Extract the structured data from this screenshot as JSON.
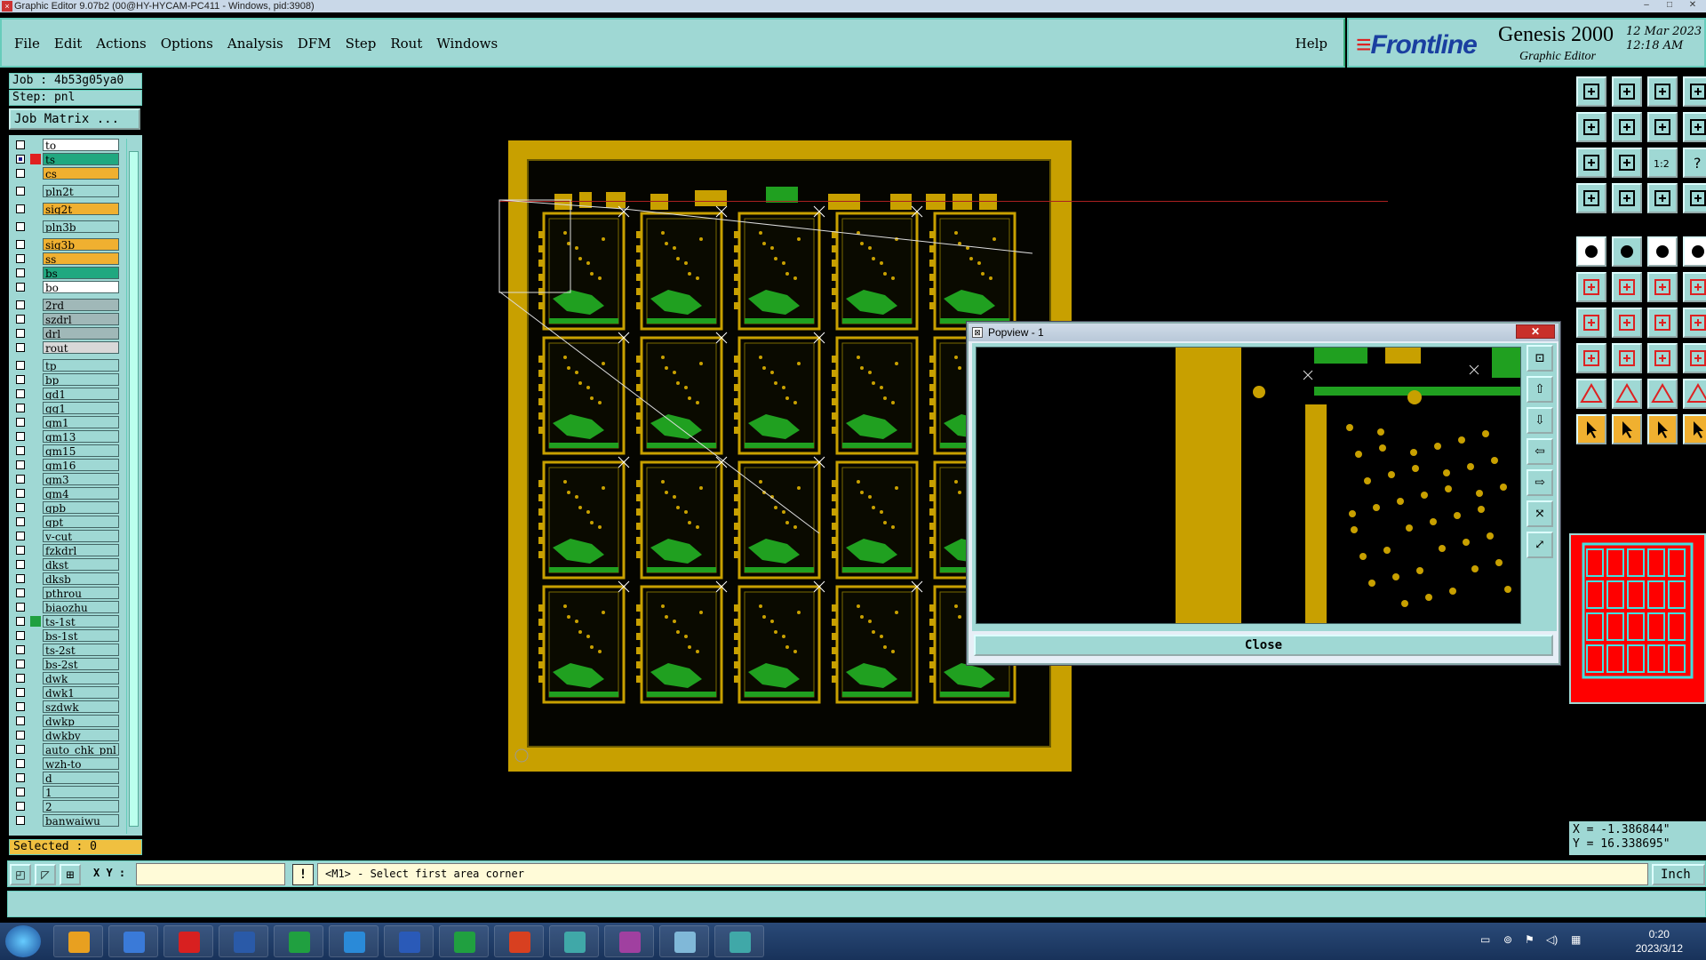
{
  "window": {
    "title": "Graphic Editor 9.07b2 (00@HY-HYCAM-PC411 - Windows, pid:3908)",
    "controls": [
      "–",
      "□",
      "✕"
    ]
  },
  "menu": {
    "items": [
      "File",
      "Edit",
      "Actions",
      "Options",
      "Analysis",
      "DFM",
      "Step",
      "Rout",
      "Windows"
    ],
    "help": "Help"
  },
  "brand": {
    "logo_stripes": "≡",
    "logo": "Frontline",
    "product": "Genesis 2000",
    "subtitle": "Graphic Editor",
    "date": "12 Mar 2023",
    "time": "12:18 AM"
  },
  "job": {
    "job_label": "Job : 4b53g05ya0",
    "step_label": "Step: pnl",
    "matrix_button": "Job Matrix ..."
  },
  "layers": [
    {
      "name": "to",
      "color": "#ffffff",
      "checked": false,
      "swatch": "",
      "gap": 0
    },
    {
      "name": "ts",
      "color": "#20a880",
      "checked": true,
      "swatch": "#e02020",
      "gap": 0
    },
    {
      "name": "cs",
      "color": "#f0b030",
      "checked": false,
      "swatch": "",
      "gap": 0
    },
    {
      "name": "pln2t",
      "color": "#9fd8d4",
      "checked": false,
      "swatch": "",
      "gap": 4
    },
    {
      "name": "sig2t",
      "color": "#f0b030",
      "checked": false,
      "swatch": "",
      "gap": 4
    },
    {
      "name": "pln3b",
      "color": "#9fd8d4",
      "checked": false,
      "swatch": "",
      "gap": 4
    },
    {
      "name": "sig3b",
      "color": "#f0b030",
      "checked": false,
      "swatch": "",
      "gap": 4
    },
    {
      "name": "ss",
      "color": "#f0b030",
      "checked": false,
      "swatch": "",
      "gap": 0
    },
    {
      "name": "bs",
      "color": "#20a880",
      "checked": false,
      "swatch": "",
      "gap": 0
    },
    {
      "name": "bo",
      "color": "#ffffff",
      "checked": false,
      "swatch": "",
      "gap": 0
    },
    {
      "name": "2rd",
      "color": "#a0b8b8",
      "checked": false,
      "swatch": "",
      "gap": 4
    },
    {
      "name": "szdrl",
      "color": "#a0b8b8",
      "checked": false,
      "swatch": "",
      "gap": 0
    },
    {
      "name": "drl",
      "color": "#a0b8b8",
      "checked": false,
      "swatch": "",
      "gap": 0
    },
    {
      "name": "rout",
      "color": "#d8d8d8",
      "checked": false,
      "swatch": "",
      "gap": 0
    },
    {
      "name": "tp",
      "color": "#9fd8d4",
      "checked": false,
      "swatch": "",
      "gap": 4
    },
    {
      "name": "bp",
      "color": "#9fd8d4",
      "checked": false,
      "swatch": "",
      "gap": 0
    },
    {
      "name": "gd1",
      "color": "#9fd8d4",
      "checked": false,
      "swatch": "",
      "gap": 0
    },
    {
      "name": "gg1",
      "color": "#9fd8d4",
      "checked": false,
      "swatch": "",
      "gap": 0
    },
    {
      "name": "gm1",
      "color": "#9fd8d4",
      "checked": false,
      "swatch": "",
      "gap": 0
    },
    {
      "name": "gm13",
      "color": "#9fd8d4",
      "checked": false,
      "swatch": "",
      "gap": 0
    },
    {
      "name": "gm15",
      "color": "#9fd8d4",
      "checked": false,
      "swatch": "",
      "gap": 0
    },
    {
      "name": "gm16",
      "color": "#9fd8d4",
      "checked": false,
      "swatch": "",
      "gap": 0
    },
    {
      "name": "gm3",
      "color": "#9fd8d4",
      "checked": false,
      "swatch": "",
      "gap": 0
    },
    {
      "name": "gm4",
      "color": "#9fd8d4",
      "checked": false,
      "swatch": "",
      "gap": 0
    },
    {
      "name": "gpb",
      "color": "#9fd8d4",
      "checked": false,
      "swatch": "",
      "gap": 0
    },
    {
      "name": "gpt",
      "color": "#9fd8d4",
      "checked": false,
      "swatch": "",
      "gap": 0
    },
    {
      "name": "v-cut",
      "color": "#9fd8d4",
      "checked": false,
      "swatch": "",
      "gap": 0
    },
    {
      "name": "fzkdrl",
      "color": "#9fd8d4",
      "checked": false,
      "swatch": "",
      "gap": 0
    },
    {
      "name": "dkst",
      "color": "#9fd8d4",
      "checked": false,
      "swatch": "",
      "gap": 0
    },
    {
      "name": "dksb",
      "color": "#9fd8d4",
      "checked": false,
      "swatch": "",
      "gap": 0
    },
    {
      "name": "pthrou",
      "color": "#9fd8d4",
      "checked": false,
      "swatch": "",
      "gap": 0
    },
    {
      "name": "biaozhu",
      "color": "#9fd8d4",
      "checked": false,
      "swatch": "",
      "gap": 0
    },
    {
      "name": "ts-1st",
      "color": "#9fd8d4",
      "checked": false,
      "swatch": "#20a040",
      "gap": 0
    },
    {
      "name": "bs-1st",
      "color": "#9fd8d4",
      "checked": false,
      "swatch": "",
      "gap": 0
    },
    {
      "name": "ts-2st",
      "color": "#9fd8d4",
      "checked": false,
      "swatch": "",
      "gap": 0
    },
    {
      "name": "bs-2st",
      "color": "#9fd8d4",
      "checked": false,
      "swatch": "",
      "gap": 0
    },
    {
      "name": "dwk",
      "color": "#9fd8d4",
      "checked": false,
      "swatch": "",
      "gap": 0
    },
    {
      "name": "dwk1",
      "color": "#9fd8d4",
      "checked": false,
      "swatch": "",
      "gap": 0
    },
    {
      "name": "szdwk",
      "color": "#9fd8d4",
      "checked": false,
      "swatch": "",
      "gap": 0
    },
    {
      "name": "dwkp",
      "color": "#9fd8d4",
      "checked": false,
      "swatch": "",
      "gap": 0
    },
    {
      "name": "dwkby",
      "color": "#9fd8d4",
      "checked": false,
      "swatch": "",
      "gap": 0
    },
    {
      "name": "auto_chk_pnl",
      "color": "#9fd8d4",
      "checked": false,
      "swatch": "",
      "gap": 0
    },
    {
      "name": "wzh-to",
      "color": "#9fd8d4",
      "checked": false,
      "swatch": "",
      "gap": 0
    },
    {
      "name": "d",
      "color": "#9fd8d4",
      "checked": false,
      "swatch": "",
      "gap": 0
    },
    {
      "name": "1",
      "color": "#9fd8d4",
      "checked": false,
      "swatch": "",
      "gap": 0
    },
    {
      "name": "2",
      "color": "#9fd8d4",
      "checked": false,
      "swatch": "",
      "gap": 0
    },
    {
      "name": "banwaiwu",
      "color": "#9fd8d4",
      "checked": false,
      "swatch": "",
      "gap": 0
    }
  ],
  "selected": "Selected : 0",
  "popview": {
    "title": "Popview - 1",
    "title_icon": "⊠",
    "close_x": "✕",
    "close_button": "Close",
    "tools": [
      "pan-icon",
      "up-icon",
      "down-icon",
      "left-icon",
      "right-icon",
      "zoom-fit-icon",
      "zoom-out-icon"
    ],
    "tool_glyphs": [
      "⊡",
      "⇧",
      "⇩",
      "⇦",
      "⇨",
      "⤧",
      "⤢"
    ]
  },
  "tools": {
    "zoom_ratio": "1:2",
    "help": "?"
  },
  "coords": {
    "x": "X = -1.386844\"",
    "y": "Y = 16.338695\""
  },
  "status": {
    "xy_label": "X Y :",
    "xy_value": "",
    "bang": "!",
    "message": "<M1> - Select first area corner",
    "unit": "Inch"
  },
  "taskbar": {
    "time": "0:20",
    "date": "2023/3/12",
    "apps": [
      "spiral-app-icon",
      "notes-app-icon",
      "red-swirl-app-icon",
      "save-disk-app-icon",
      "green-p-app-icon",
      "arrow-app-icon",
      "word-app-icon",
      "excel-app-icon",
      "presentation-app-icon",
      "eye-app-icon",
      "x-app-icon",
      "square-app-icon",
      "eye-app-icon-2"
    ]
  },
  "colors": {
    "panel": "#9fd8d4",
    "board_frame": "#c8a000",
    "copper_green": "#20a020",
    "background": "#000000",
    "minimap_red": "#ff0000",
    "minimap_cyan": "#40e0e0"
  }
}
